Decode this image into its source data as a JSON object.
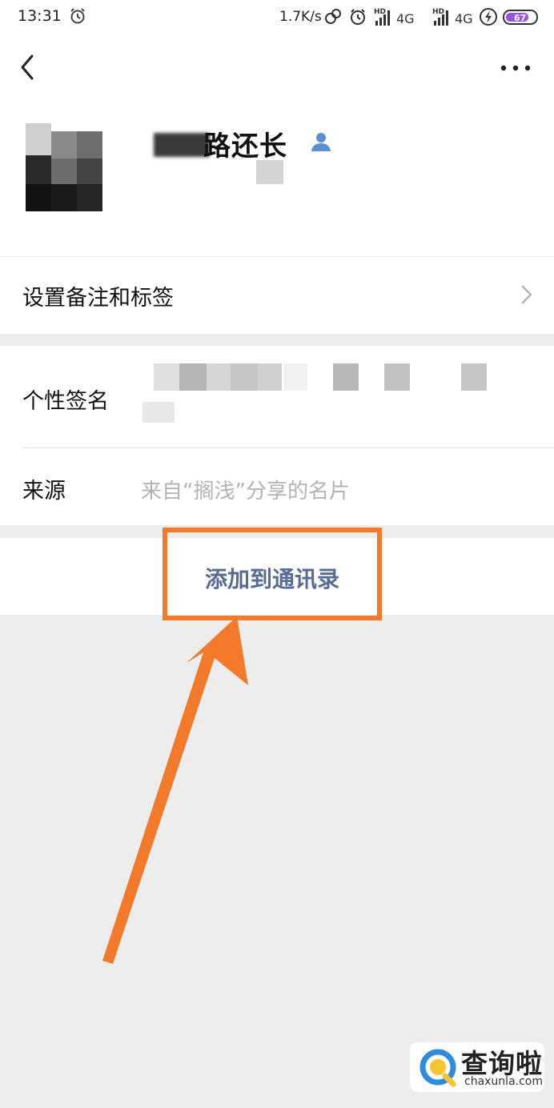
{
  "status_bar": {
    "time": "13:31",
    "net_speed": "1.7K/s",
    "signal_1": "4G",
    "signal_2": "4G",
    "hd_1": "HD",
    "hd_2": "HD",
    "battery": "67",
    "icons": [
      "alarm-icon",
      "link-icon",
      "alarm-icon",
      "signal-icon",
      "signal-icon",
      "charging-icon",
      "battery-icon"
    ]
  },
  "navbar": {
    "back_icon": "back-icon",
    "more_icon": "more-icon"
  },
  "profile": {
    "nickname": "路还长",
    "badge_icon": "contact-icon"
  },
  "settings": {
    "remark_label": "设置备注和标签"
  },
  "info": {
    "signature_label": "个性签名",
    "source_label": "来源",
    "source_value": "来自“搁浅”分享的名片"
  },
  "actions": {
    "add_to_contacts": "添加到通讯录"
  },
  "annotation": {
    "color": "#f47a2b"
  },
  "watermark": {
    "title": "查询啦",
    "url": "chaxunla.com"
  },
  "colors": {
    "link": "#576b95",
    "background": "#ededed",
    "annotation": "#f47a2b"
  }
}
